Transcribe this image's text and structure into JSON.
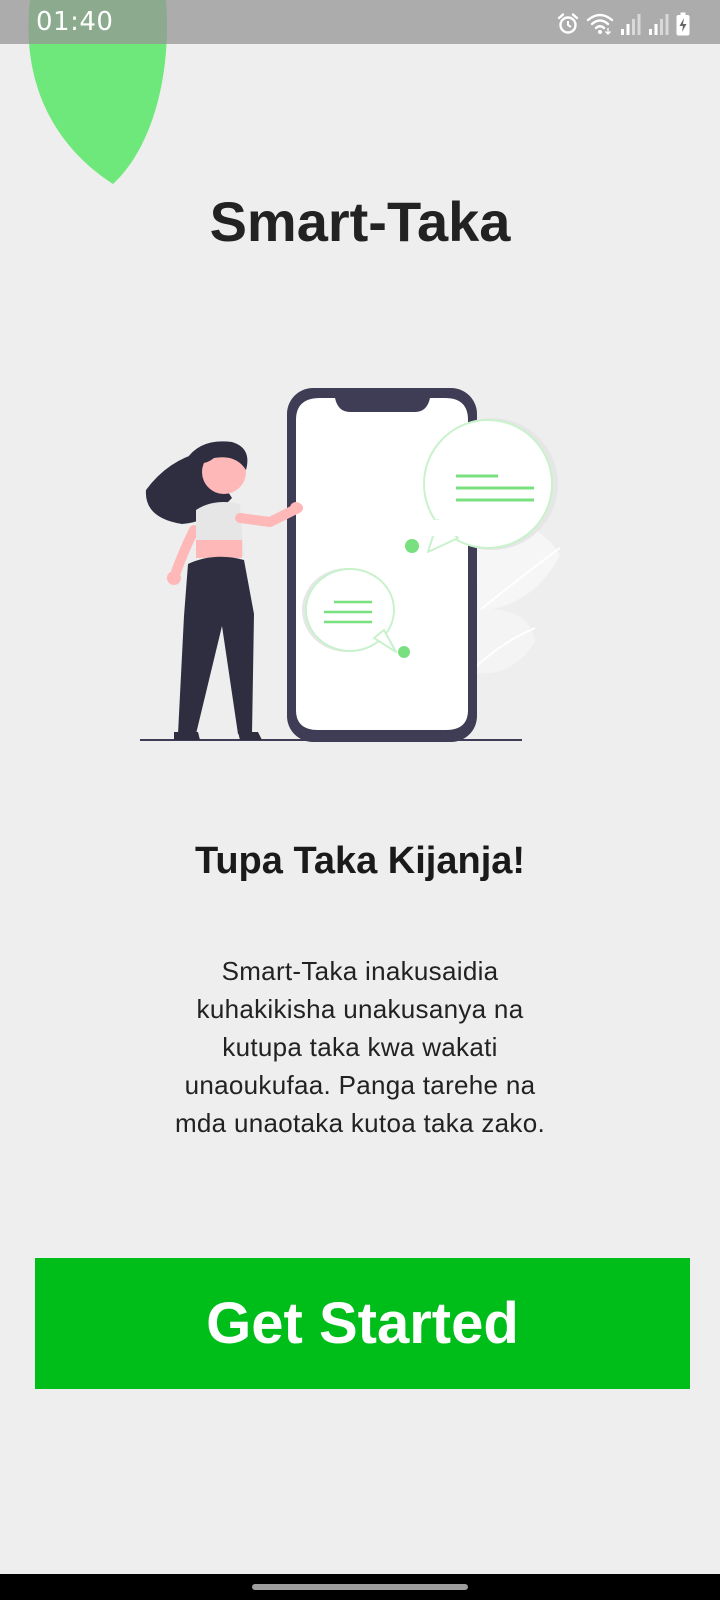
{
  "status_bar": {
    "time": "01:40",
    "icons": [
      "alarm-icon",
      "wifi-icon",
      "signal-icon",
      "signal-icon",
      "battery-charging-icon"
    ]
  },
  "onboarding": {
    "title": "Smart-Taka",
    "illustration": "woman-with-phone-chat-illustration",
    "subtitle": "Tupa Taka Kijanja!",
    "description": "Smart-Taka inakusaidia kuhakikisha unakusanya na kutupa taka kwa wakati unaoukufaa. Panga tarehe na mda unaotaka kutoa taka zako.",
    "cta_label": "Get Started"
  },
  "colors": {
    "accent_green": "#00be19",
    "leaf_green": "#6ee87a",
    "background": "#eeeeee",
    "text_dark": "#222222"
  }
}
